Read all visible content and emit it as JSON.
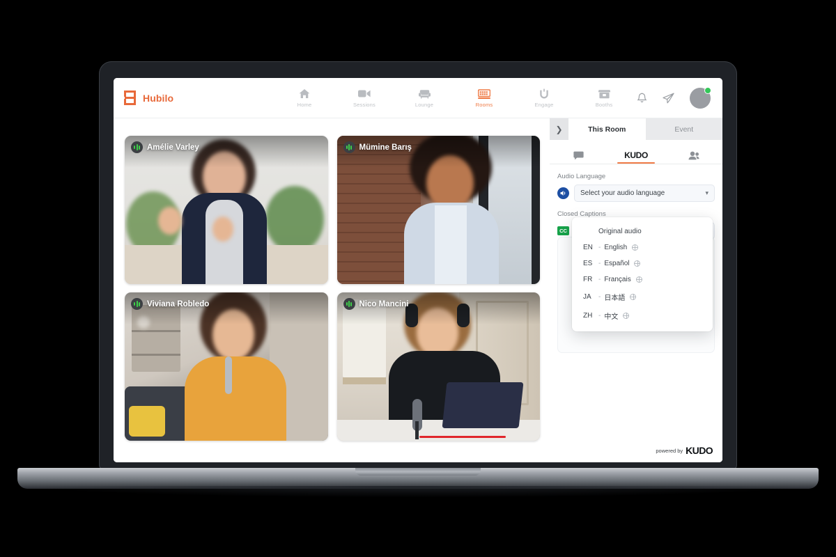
{
  "brand": {
    "name": "Hubilo",
    "logo_icon": "hubilo-logo-icon",
    "accent": "#e8693a"
  },
  "nav": {
    "items": [
      {
        "label": "Home",
        "icon": "home-icon",
        "active": false
      },
      {
        "label": "Sessions",
        "icon": "video-camera-icon",
        "active": false
      },
      {
        "label": "Lounge",
        "icon": "armchair-icon",
        "active": false
      },
      {
        "label": "Rooms",
        "icon": "rooms-grid-icon",
        "active": true
      },
      {
        "label": "Engage",
        "icon": "magnet-icon",
        "active": false
      },
      {
        "label": "Booths",
        "icon": "booth-icon",
        "active": false
      }
    ]
  },
  "topbar_right": {
    "notifications_icon": "bell-icon",
    "send_icon": "paper-plane-icon",
    "avatar_icon": "avatar",
    "status_color": "#34c759"
  },
  "stage": {
    "tiles": [
      {
        "name": "Amélie Varley",
        "mic_icon": "audio-level-icon"
      },
      {
        "name": "Mümine Barış",
        "mic_icon": "audio-level-icon"
      },
      {
        "name": "Viviana Robledo",
        "mic_icon": "audio-level-icon"
      },
      {
        "name": "Nico Mancini",
        "mic_icon": "audio-level-icon"
      }
    ]
  },
  "panel": {
    "collapse_icon": "chevron-right-icon",
    "tabs": [
      {
        "label": "This Room",
        "active": true
      },
      {
        "label": "Event",
        "active": false
      }
    ],
    "icon_tabs": [
      {
        "name": "chat-icon",
        "label": "",
        "active": false
      },
      {
        "name": "kudo-tab",
        "label": "KUDO",
        "active": true
      },
      {
        "name": "participants-icon",
        "label": "",
        "active": false
      }
    ],
    "audio": {
      "label": "Audio Language",
      "speaker_icon": "speaker-icon",
      "selected": "Select your audio language",
      "placeholder": "Select your audio language",
      "caret_icon": "chevron-down-icon"
    },
    "captions": {
      "label": "Closed Captions",
      "badge": "CC",
      "badge_color": "#17a34a"
    },
    "dropdown": {
      "options": [
        {
          "code": "",
          "dash": "",
          "name": "Original audio",
          "globe": false
        },
        {
          "code": "EN",
          "dash": "-",
          "name": "English",
          "globe": true
        },
        {
          "code": "ES",
          "dash": "-",
          "name": "Español",
          "globe": true
        },
        {
          "code": "FR",
          "dash": "-",
          "name": "Français",
          "globe": true
        },
        {
          "code": "JA",
          "dash": "-",
          "name": "日本語",
          "globe": true
        },
        {
          "code": "ZH",
          "dash": "-",
          "name": "中文",
          "globe": true
        }
      ]
    },
    "footer": {
      "powered_by": "powered by",
      "logo_text": "KUDO"
    }
  },
  "theme": {
    "accent": "#ef7a45",
    "panel_bg": "#ffffff",
    "page_bg": "#f4f5f7"
  }
}
